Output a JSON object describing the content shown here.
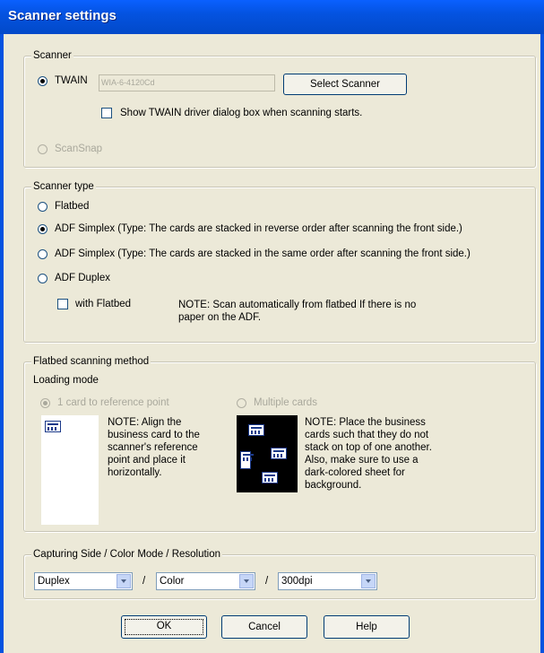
{
  "window": {
    "title": "Scanner settings"
  },
  "scanner": {
    "legend": "Scanner",
    "twain_label": "TWAIN",
    "twain_device": "WIA-6-4120Cd",
    "select_scanner_label": "Select Scanner",
    "show_driver_label": "Show TWAIN driver dialog box when scanning starts.",
    "scansnap_label": "ScanSnap"
  },
  "scanner_type": {
    "legend": "Scanner type",
    "flatbed": "Flatbed",
    "adf_simplex_reverse": "ADF Simplex (Type: The cards are stacked in reverse order after scanning the front side.)",
    "adf_simplex_same": "ADF Simplex (Type: The cards are stacked in the same order after scanning the front side.)",
    "adf_duplex": "ADF Duplex",
    "with_flatbed": "with Flatbed",
    "note": "NOTE: Scan automatically from flatbed If there is no paper on the ADF."
  },
  "flatbed": {
    "legend": "Flatbed scanning method",
    "loading_mode": "Loading mode",
    "one_card": "1 card to reference point",
    "one_card_note": "NOTE: Align the business card to the scanner's reference point and place it horizontally.",
    "multiple": "Multiple cards",
    "multiple_note": "NOTE: Place the business cards such that they do not stack on top of one another. Also, make sure to use a dark-colored sheet for background."
  },
  "capture": {
    "legend": "Capturing Side / Color Mode / Resolution",
    "side": "Duplex",
    "color": "Color",
    "resolution": "300dpi",
    "sep1": "/",
    "sep2": "/"
  },
  "buttons": {
    "ok": "OK",
    "cancel": "Cancel",
    "help": "Help"
  }
}
